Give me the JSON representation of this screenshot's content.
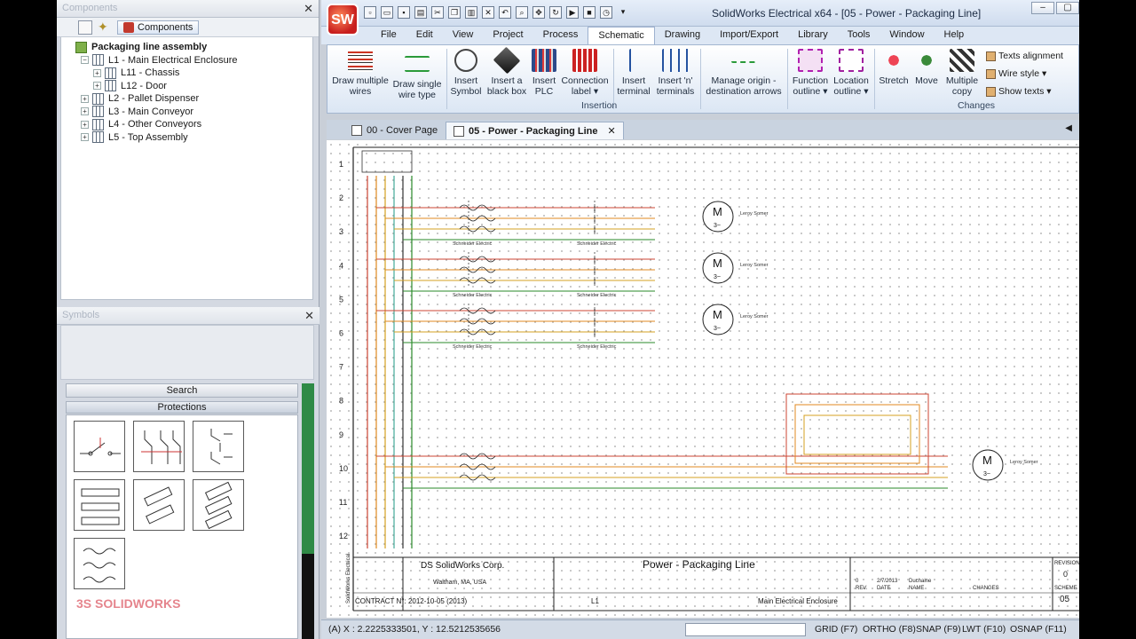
{
  "left_panel": {
    "components_title": "Components",
    "components_button": "Components",
    "tree": [
      {
        "label": "Packaging line assembly",
        "level": 0,
        "expander": "",
        "root": true
      },
      {
        "label": "L1 - Main Electrical Enclosure",
        "level": 1,
        "expander": "−"
      },
      {
        "label": "L11 - Chassis",
        "level": 2,
        "expander": "+"
      },
      {
        "label": "L12 - Door",
        "level": 2,
        "expander": "+"
      },
      {
        "label": "L2 - Pallet Dispenser",
        "level": 1,
        "expander": "+"
      },
      {
        "label": "L3 - Main Conveyor",
        "level": 1,
        "expander": "+"
      },
      {
        "label": "L4 - Other Conveyors",
        "level": 1,
        "expander": "+"
      },
      {
        "label": "L5 - Top Assembly",
        "level": 1,
        "expander": "+"
      }
    ],
    "symbols_title": "Symbols",
    "search_label": "Search",
    "protections_label": "Protections"
  },
  "window": {
    "title": "SolidWorks Electrical x64 - [05 - Power - Packaging Line]",
    "logo": "SW"
  },
  "menus": [
    "File",
    "Edit",
    "View",
    "Project",
    "Process",
    "Schematic",
    "Drawing",
    "Import/Export",
    "Library",
    "Tools",
    "Window",
    "Help"
  ],
  "active_menu": "Schematic",
  "ribbon": {
    "draw_multiple": "Draw multiple\nwires",
    "draw_single": "Draw single\nwire type",
    "insert_symbol": "Insert\nSymbol",
    "insert_black_box": "Insert a\nblack box",
    "insert_plc": "Insert\nPLC",
    "connection_label": "Connection\nlabel ▾",
    "insert_terminal": "Insert\nterminal",
    "insert_n_terminals": "Insert 'n'\nterminals",
    "manage_origin": "Manage origin -\ndestination arrows",
    "function_outline": "Function\noutline ▾",
    "location_outline": "Location\noutline ▾",
    "stretch": "Stretch",
    "move": "Move",
    "multiple_copy": "Multiple\ncopy",
    "texts_alignment": "Texts alignment",
    "wire_style": "Wire style ▾",
    "show_texts": "Show texts ▾",
    "group_insertion": "Insertion",
    "group_changes": "Changes"
  },
  "tabs": [
    {
      "label": "00 - Cover Page",
      "active": false
    },
    {
      "label": "05 - Power - Packaging Line",
      "active": true
    }
  ],
  "schematic": {
    "row_numbers": [
      "1",
      "2",
      "3",
      "4",
      "5",
      "6",
      "7",
      "8",
      "9",
      "10",
      "11",
      "12"
    ],
    "company": "DS SolidWorks Corp.",
    "address": "Waltham, MA, USA",
    "drawing_title": "Power - Packaging Line",
    "contract": "CONTRACT N°: 2012-10-05 (2013)",
    "location_code": "L1",
    "location_name": "Main Electrical Enclosure",
    "revision_label": "REVISION",
    "revision": "0",
    "scheme_label": "SCHEME",
    "scheme": "05",
    "rev_hdr": "REV.",
    "date_hdr": "DATE",
    "name_hdr": "NAME",
    "changes_hdr": "CHANGES",
    "rev_val": "0",
    "date_val": "2/7/2013",
    "name_val": "Duchaine",
    "motor_letter": "M",
    "motor_phase": "3~",
    "breaker_brand": "Schneider Electric",
    "contactor_brand": "Schneider Electric",
    "motor_brand": "Leroy Somer",
    "side_label": "SolidWorks Electrical"
  },
  "status": {
    "coords": "(A) X : 2.2225333501, Y : 12.5212535656",
    "grid": "GRID (F7)",
    "ortho": "ORTHO (F8)",
    "snap": "SNAP (F9)",
    "lwt": "LWT (F10)",
    "osnap": "OSNAP (F11)"
  }
}
